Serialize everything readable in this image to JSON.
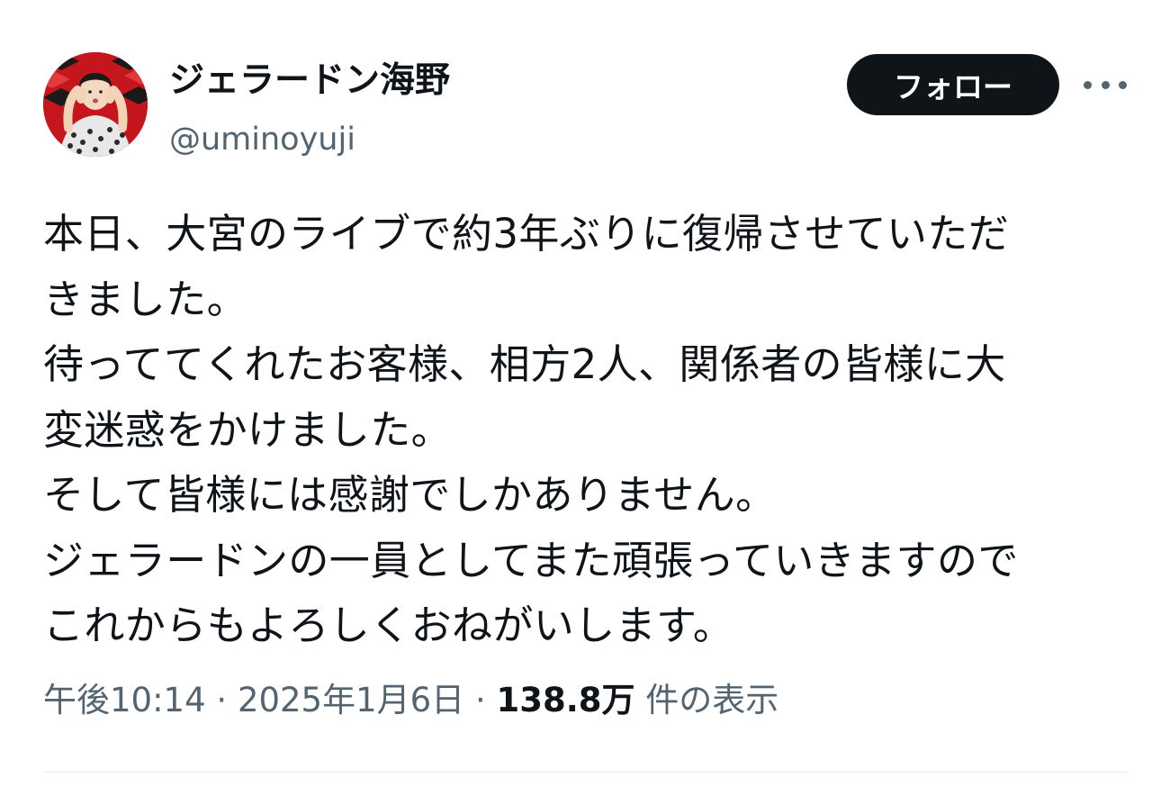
{
  "author": {
    "display_name": "ジェラードン海野",
    "handle": "@uminoyuji",
    "avatar_icon": "avatar-photo-icon"
  },
  "actions": {
    "follow_label": "フォロー",
    "more_icon": "more-dots-icon"
  },
  "tweet": {
    "lines": [
      "本日、大宮のライブで約3年ぶりに復帰させていただ",
      "きました。",
      "待っててくれたお客様、相方2人、関係者の皆様に大",
      "変迷惑をかけました。",
      "そして皆様には感謝でしかありません。",
      "ジェラードンの一員としてまた頑張っていきますので",
      "これからもよろしくおねがいします。"
    ]
  },
  "meta": {
    "time": "午後10:14",
    "separator": " · ",
    "date": "2025年1月6日",
    "views_count": "138.8万",
    "views_label": " 件の表示"
  },
  "colors": {
    "text": "#0f1419",
    "secondary": "#536471",
    "button_bg": "#0f1419",
    "avatar_bg": "#c4161c"
  }
}
